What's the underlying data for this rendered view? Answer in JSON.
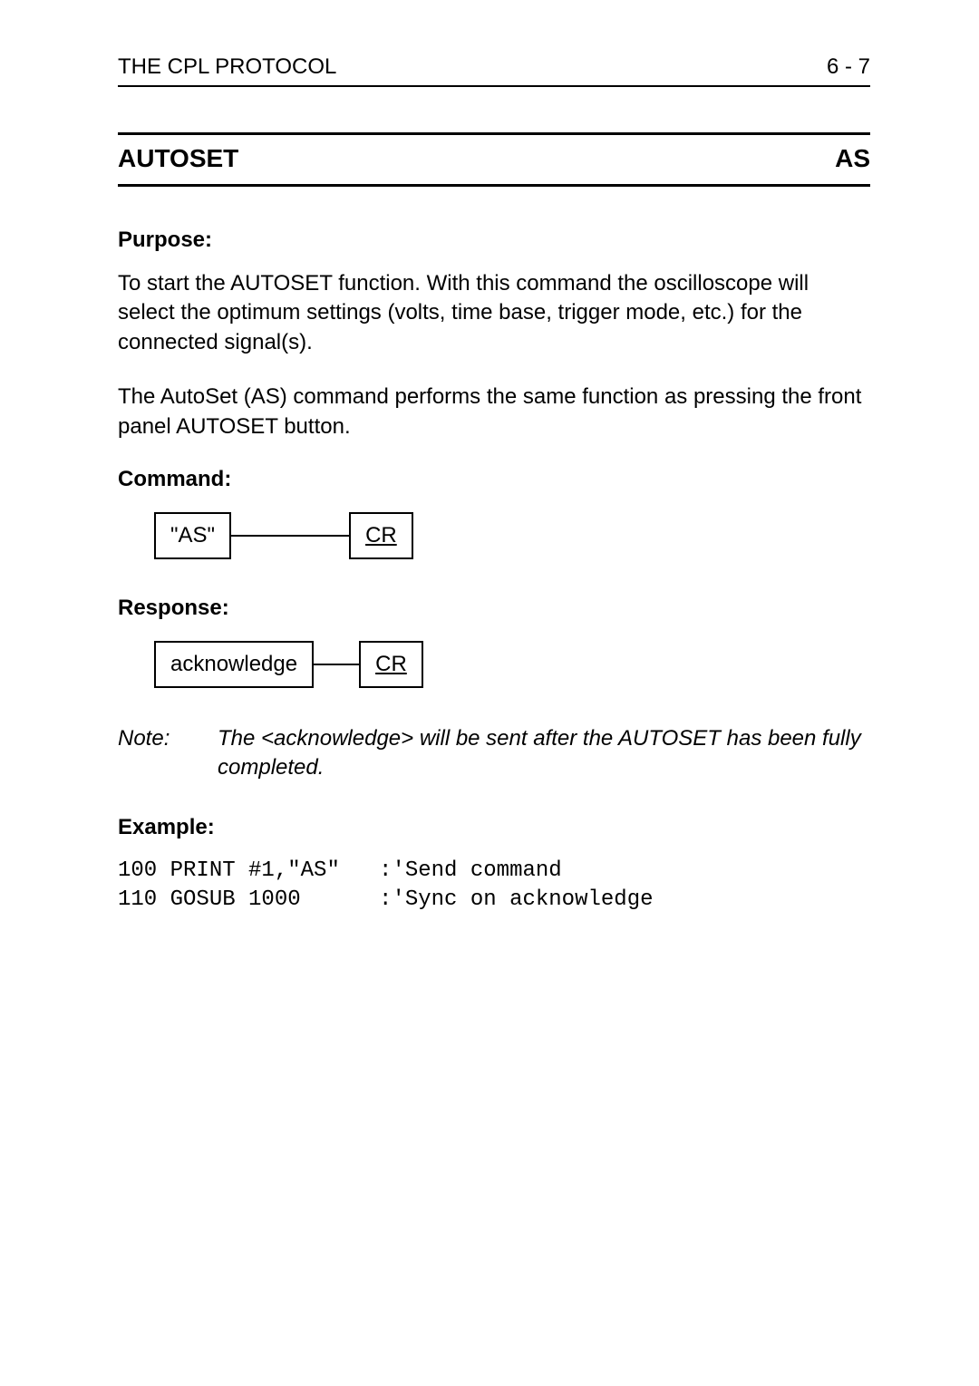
{
  "header": {
    "left": "THE CPL PROTOCOL",
    "right": "6 - 7"
  },
  "title": {
    "left": "AUTOSET",
    "right": "AS"
  },
  "purpose": {
    "heading": "Purpose:",
    "para1": "To start the AUTOSET function. With this command the oscilloscope will select the optimum settings (volts, time base, trigger mode, etc.) for the connected signal(s).",
    "para2": "The AutoSet (AS) command performs the same function as pressing the front panel AUTOSET button."
  },
  "command": {
    "heading": "Command:",
    "box1": "\"AS\"",
    "box2": "CR"
  },
  "response": {
    "heading": "Response:",
    "box1": "acknowledge",
    "box2": "CR"
  },
  "note": {
    "label": "Note:",
    "text": "The <acknowledge> will be sent after the AUTOSET has been fully completed."
  },
  "example": {
    "heading": "Example:",
    "line1": "100 PRINT #1,\"AS\"   :'Send command",
    "line2": "110 GOSUB 1000      :'Sync on acknowledge"
  }
}
